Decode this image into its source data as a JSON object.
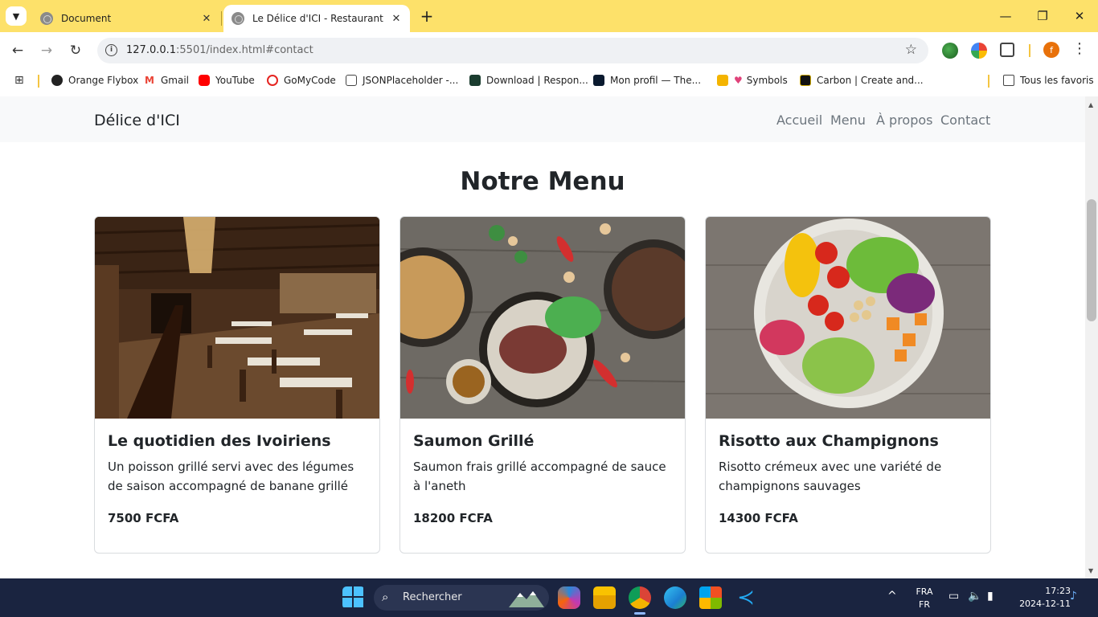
{
  "browser": {
    "tabs": [
      {
        "title": "Document",
        "active": false
      },
      {
        "title": "Le Délice d'ICI - Restaurant",
        "active": true
      }
    ],
    "url_host": "127.0.0.1",
    "url_rest": ":5501/index.html#contact",
    "profile_initial": "f",
    "bookmarks": [
      {
        "label": "Orange Flybox",
        "color": "#222222"
      },
      {
        "label": "Gmail",
        "color": "#ea4335"
      },
      {
        "label": "YouTube",
        "color": "#ff0000"
      },
      {
        "label": "GoMyCode",
        "color": "#e52521"
      },
      {
        "label": "JSONPlaceholder -...",
        "color": "#444444"
      },
      {
        "label": "Download | Respon...",
        "color": "#1b3d2f"
      },
      {
        "label": "Mon profil — The...",
        "color": "#0a1a2f"
      },
      {
        "label": "Symbols",
        "color": "#e0427a"
      },
      {
        "label": "Carbon | Create and...",
        "color": "#111111"
      }
    ],
    "all_bookmarks_label": "Tous les favoris"
  },
  "site": {
    "brand": "Délice d'ICI",
    "nav": [
      "Accueil",
      "Menu",
      "À propos",
      "Contact"
    ],
    "section_title": "Notre Menu",
    "cards": [
      {
        "title": "Le quotidien des Ivoiriens",
        "description": "Un poisson grillé servi avec des légumes de saison accompagné de banane grillé",
        "price": "7500 FCFA",
        "image": "restaurant-dining-room"
      },
      {
        "title": "Saumon Grillé",
        "description": "Saumon frais grillé accompagné de sauce à l'aneth",
        "price": "18200 FCFA",
        "image": "grilled-meat-bowls"
      },
      {
        "title": "Risotto aux Champignons",
        "description": "Risotto crémeux avec une variété de champignons sauvages",
        "price": "14300 FCFA",
        "image": "vegetable-salad-bowl"
      }
    ]
  },
  "taskbar": {
    "search_label": "Rechercher",
    "language": "FRA",
    "layout": "FR",
    "time": "17:23",
    "date": "2024-12-11"
  },
  "colors": {
    "tab_strip": "#fde16a",
    "taskbar": "#1a2440",
    "navbar": "#f8f9fa"
  }
}
